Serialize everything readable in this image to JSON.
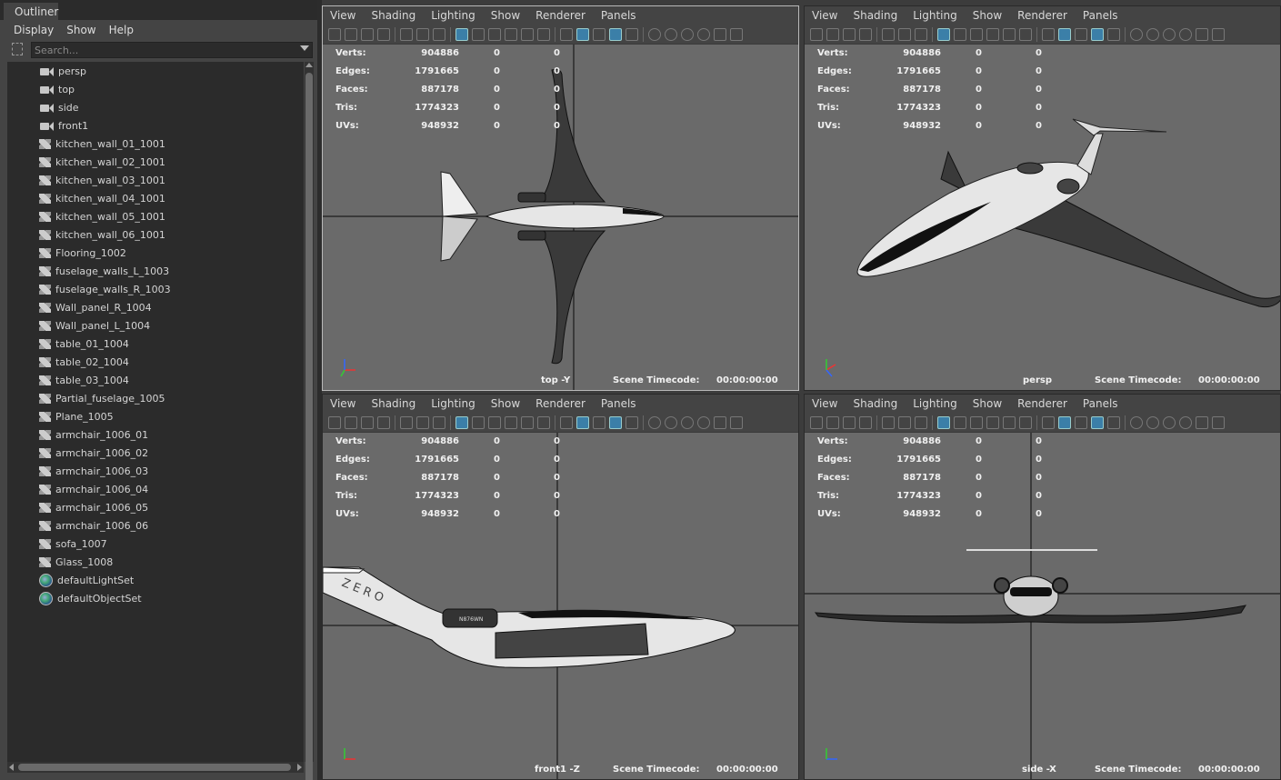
{
  "outliner": {
    "tab": "Outliner",
    "menu": [
      "Display",
      "Show",
      "Help"
    ],
    "search_placeholder": "Search...",
    "items": [
      {
        "label": "persp",
        "icon": "camera-icon"
      },
      {
        "label": "top",
        "icon": "camera-icon"
      },
      {
        "label": "side",
        "icon": "camera-icon"
      },
      {
        "label": "front1",
        "icon": "camera-icon"
      },
      {
        "label": "kitchen_wall_01_1001",
        "icon": "mesh-icon"
      },
      {
        "label": "kitchen_wall_02_1001",
        "icon": "mesh-icon"
      },
      {
        "label": "kitchen_wall_03_1001",
        "icon": "mesh-icon"
      },
      {
        "label": "kitchen_wall_04_1001",
        "icon": "mesh-icon"
      },
      {
        "label": "kitchen_wall_05_1001",
        "icon": "mesh-icon"
      },
      {
        "label": "kitchen_wall_06_1001",
        "icon": "mesh-icon"
      },
      {
        "label": "Flooring_1002",
        "icon": "mesh-icon"
      },
      {
        "label": "fuselage_walls_L_1003",
        "icon": "mesh-icon"
      },
      {
        "label": "fuselage_walls_R_1003",
        "icon": "mesh-icon"
      },
      {
        "label": "Wall_panel_R_1004",
        "icon": "mesh-icon"
      },
      {
        "label": "Wall_panel_L_1004",
        "icon": "mesh-icon"
      },
      {
        "label": "table_01_1004",
        "icon": "mesh-icon"
      },
      {
        "label": "table_02_1004",
        "icon": "mesh-icon"
      },
      {
        "label": "table_03_1004",
        "icon": "mesh-icon"
      },
      {
        "label": "Partial_fuselage_1005",
        "icon": "mesh-icon"
      },
      {
        "label": "Plane_1005",
        "icon": "mesh-icon"
      },
      {
        "label": "armchair_1006_01",
        "icon": "mesh-icon"
      },
      {
        "label": "armchair_1006_02",
        "icon": "mesh-icon"
      },
      {
        "label": "armchair_1006_03",
        "icon": "mesh-icon"
      },
      {
        "label": "armchair_1006_04",
        "icon": "mesh-icon"
      },
      {
        "label": "armchair_1006_05",
        "icon": "mesh-icon"
      },
      {
        "label": "armchair_1006_06",
        "icon": "mesh-icon"
      },
      {
        "label": "sofa_1007",
        "icon": "mesh-icon"
      },
      {
        "label": "Glass_1008",
        "icon": "mesh-icon"
      },
      {
        "label": "defaultLightSet",
        "icon": "set-icon"
      },
      {
        "label": "defaultObjectSet",
        "icon": "set-icon"
      }
    ]
  },
  "viewport_menu": [
    "View",
    "Shading",
    "Lighting",
    "Show",
    "Renderer",
    "Panels"
  ],
  "stats": [
    {
      "key": "Verts:",
      "value": "904886",
      "a": "0",
      "b": "0"
    },
    {
      "key": "Edges:",
      "value": "1791665",
      "a": "0",
      "b": "0"
    },
    {
      "key": "Faces:",
      "value": "887178",
      "a": "0",
      "b": "0"
    },
    {
      "key": "Tris:",
      "value": "1774323",
      "a": "0",
      "b": "0"
    },
    {
      "key": "UVs:",
      "value": "948932",
      "a": "0",
      "b": "0"
    }
  ],
  "timecode_label": "Scene Timecode:",
  "timecode_value": "00:00:00:00",
  "viewports": [
    {
      "camera": "top -Y"
    },
    {
      "camera": "persp"
    },
    {
      "camera": "front1 -Z"
    },
    {
      "camera": "side -X"
    }
  ],
  "tail_lettering": "ZERO",
  "engine_lettering": "N876WN",
  "colors": {
    "viewport_bg": "#6a6a6a",
    "panel_bg": "#444444",
    "active_border": "#b8b8b8",
    "toggle_on": "#3b7fa8"
  }
}
